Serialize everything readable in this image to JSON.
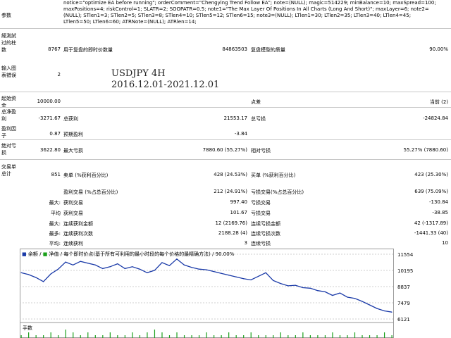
{
  "params": {
    "label": "参数",
    "lines": [
      "notice=\"optimize EA before running\"; orderComment=\"Chengying Trend Follow EA\"; note=(NULL); magic=514229; minBalance=10; maxSpread=100;",
      "maxPositions=4; riskControl=1; SLATR=2; SOOPATR=0.5; note1=\"The Max Layer Of Positions In All Charts (Long And Short)\"; maxLayer=6; note2=",
      "(NULL); STlen1=3; STlen2=5; STlen3=8; STlen4=10; STlen5=12; STlen6=15; note3=(NULL); LTlen1=30; LTlen2=35; LTlen3=40; LTlen4=45;",
      "LTlen5=50; LTlen6=60; ATRNote=(NULL); ATRlen=14;"
    ]
  },
  "overlay": {
    "symbol": "USDJPY 4H",
    "range": "2016.12.01-2021.12.01"
  },
  "stats": {
    "bars_label": "経測試过的柱数",
    "bars": "8767",
    "ticks_label": "用于复盘的即时价数量",
    "ticks": "84863503",
    "quality_label": "复盘模型的质量",
    "quality": "90.00%",
    "errors_label": "输入图表错误",
    "errors": "2",
    "deposit_label": "起始资金",
    "deposit": "10000.00",
    "spread_label": "点差",
    "spread": "当前 (2)",
    "net_label": "总净盈利",
    "net": "-3271.67",
    "gross_profit_label": "总获利",
    "gross_profit": "21553.17",
    "gross_loss_label": "总亏损",
    "gross_loss": "-24824.84",
    "pf_label": "盈利因子",
    "pf": "0.87",
    "expected_label": "预期盈利",
    "expected": "-3.84",
    "abs_dd_label": "绝对亏损",
    "abs_dd": "3622.80",
    "max_dd_label": "最大亏损",
    "max_dd": "7880.60 (55.27%)",
    "rel_dd_label": "相对亏损",
    "rel_dd": "55.27% (7880.60)",
    "trades_label": "交易单总计",
    "trades": "851",
    "short_label": "卖单 (%获利百分比)",
    "short": "428 (24.53%)",
    "long_label": "买单 (%获利百分比)",
    "long": "423 (25.30%)",
    "profit_trades_label": "盈利交易 (%占总百分比)",
    "profit_trades": "212 (24.91%)",
    "loss_trades_label": "亏损交易(%占总百分比)",
    "loss_trades": "639 (75.09%)",
    "largest_prefix": "最大:",
    "largest_profit_label": "获利交易",
    "largest_profit": "997.40",
    "largest_loss_label": "亏损交易",
    "largest_loss": "-130.84",
    "avg_prefix": "平均",
    "avg_profit_label": "获利交易",
    "avg_profit": "101.67",
    "avg_loss_label": "亏损交易",
    "avg_loss": "-38.85",
    "max_prefix": "最大:",
    "max_cons_wins_label": "连续获利金额",
    "max_cons_wins": "12 (2169.76)",
    "max_cons_losses_label": "连续亏损金额",
    "max_cons_losses": "42 (-1317.89)",
    "most_prefix": "最多:",
    "max_cons_profit_label": "连续获利次数",
    "max_cons_profit": "2188.28 (4)",
    "max_cons_loss_label": "连续亏损次数",
    "max_cons_loss": "-1441.33 (40)",
    "avgc_prefix": "平均:",
    "avg_cons_wins_label": "连续获利",
    "avg_cons_wins": "3",
    "avg_cons_losses_label": "连续亏损",
    "avg_cons_losses": "10"
  },
  "chart": {
    "legend": {
      "balance": "余额",
      "equity": "净值",
      "description": "每个即时价点(基于所有可利用的最小时段的每个价格的最精确方法)",
      "quality": "90.00%"
    },
    "volume_label": "手数",
    "colors": {
      "balance": "#1a3aa8",
      "equity": "#1ba01b",
      "grid": "#cfcfcf"
    }
  },
  "chart_data": {
    "type": "line",
    "yticks": [
      "11554",
      "10195",
      "8837",
      "7479",
      "6121"
    ],
    "ylim": [
      6121,
      11554
    ],
    "x": [
      0,
      2,
      4,
      6,
      8,
      10,
      12,
      14,
      16,
      18,
      20,
      22,
      24,
      26,
      28,
      30,
      32,
      34,
      36,
      38,
      40,
      42,
      44,
      46,
      48,
      50,
      52,
      54,
      56,
      58,
      60,
      62,
      64,
      66,
      68,
      70,
      72,
      74,
      76,
      78,
      80,
      82,
      84,
      86,
      88,
      90,
      92,
      94,
      96,
      98,
      100
    ],
    "series": [
      {
        "values": [
          10000,
          9850,
          9600,
          9250,
          9900,
          10300,
          10900,
          10650,
          10950,
          10800,
          10650,
          10350,
          10500,
          10750,
          10350,
          10500,
          10300,
          10000,
          10200,
          10850,
          10600,
          11150,
          10650,
          10450,
          10300,
          10250,
          10100,
          9950,
          9800,
          9650,
          9500,
          9400,
          9700,
          10000,
          9350,
          9100,
          8900,
          8950,
          8750,
          8700,
          8500,
          8400,
          8100,
          8300,
          7950,
          7850,
          7600,
          7300,
          7000,
          6800,
          6700
        ]
      }
    ],
    "volume": [
      1,
      2,
      1,
      1,
      2,
      1,
      3,
      2,
      1,
      2,
      1,
      1,
      2,
      1,
      1,
      2,
      1,
      2,
      3,
      2,
      1,
      2,
      1,
      1,
      1,
      2,
      1,
      1,
      2,
      1,
      1,
      2,
      1,
      1,
      1,
      2,
      1,
      1,
      2,
      1,
      1,
      1,
      2,
      1,
      1,
      2,
      1,
      1,
      1,
      2,
      1
    ]
  }
}
